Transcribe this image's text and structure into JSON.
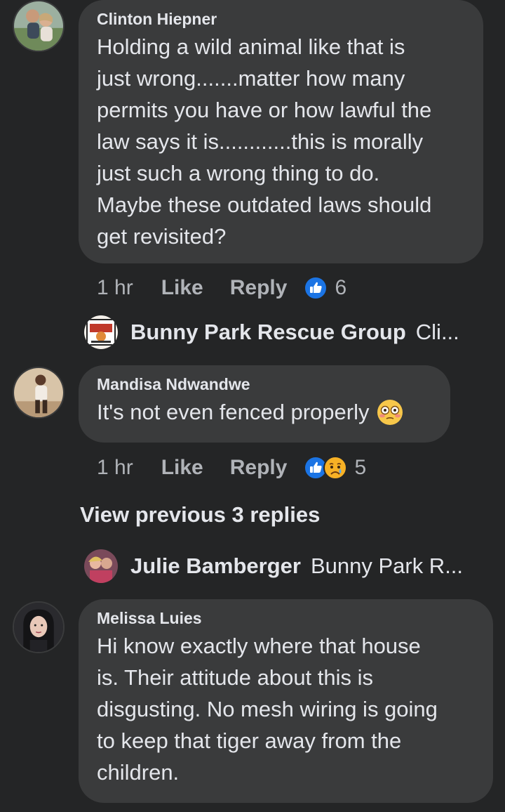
{
  "comments": [
    {
      "author": "Clinton Hiepner",
      "lines": [
        "Holding a wild animal like that is",
        "just wrong.......matter how many",
        "permits you have or how lawful the",
        "law says it is............this is morally",
        "just such a wrong thing to do.",
        "Maybe these outdated laws should",
        "get revisited?"
      ],
      "time": "1 hr",
      "like_label": "Like",
      "reply_label": "Reply",
      "reaction_count": "6"
    },
    {
      "author": "Mandisa Ndwandwe",
      "lines": [
        "It's not even fenced properly"
      ],
      "time": "1 hr",
      "like_label": "Like",
      "reply_label": "Reply",
      "reaction_count": "5"
    },
    {
      "author": "Melissa Luies",
      "lines": [
        "Hi know exactly where that house",
        "is. Their attitude about this is",
        "disgusting. No mesh wiring is going",
        "to keep that tiger away from the",
        "children."
      ]
    }
  ],
  "reply_previews": [
    {
      "name": "Bunny Park Rescue Group",
      "snippet": "Cli..."
    },
    {
      "name": "Julie Bamberger",
      "snippet": "Bunny Park R..."
    }
  ],
  "view_previous_label": "View previous 3 replies",
  "colors": {
    "background": "#242526",
    "bubble": "#3a3b3c",
    "text": "#e4e6eb",
    "muted": "#b0b3b8",
    "like_blue": "#1b74e4",
    "sad_yellow": "#f7b125"
  },
  "icons": {
    "like_reaction": "thumbs-up-icon",
    "sad_reaction": "sad-face-icon",
    "flushed_emoji": "flushed-face-emoji"
  }
}
